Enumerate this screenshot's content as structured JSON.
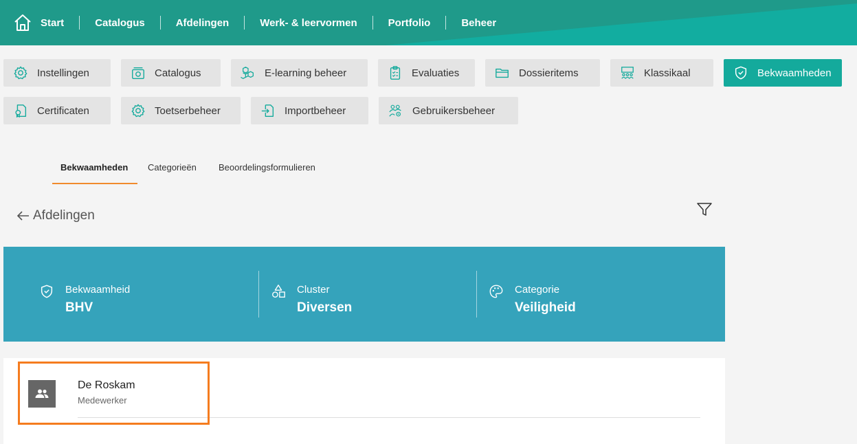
{
  "topnav": {
    "items": [
      "Start",
      "Catalogus",
      "Afdelingen",
      "Werk- & leervormen",
      "Portfolio",
      "Beheer"
    ]
  },
  "modules": [
    {
      "label": "Instellingen",
      "icon": "gear-icon"
    },
    {
      "label": "Catalogus",
      "icon": "catalog-icon"
    },
    {
      "label": "E-learning beheer",
      "icon": "cubes-icon"
    },
    {
      "label": "Evaluaties",
      "icon": "clipboard-icon"
    },
    {
      "label": "Dossieritems",
      "icon": "folder-icon"
    },
    {
      "label": "Klassikaal",
      "icon": "classroom-icon"
    },
    {
      "label": "Bekwaamheden",
      "icon": "shield-check-icon",
      "active": true
    },
    {
      "label": "Certificaten",
      "icon": "certificate-icon"
    },
    {
      "label": "Toetserbeheer",
      "icon": "gear-icon"
    },
    {
      "label": "Importbeheer",
      "icon": "import-icon"
    },
    {
      "label": "Gebruikersbeheer",
      "icon": "users-gear-icon"
    }
  ],
  "tabs": [
    "Bekwaamheden",
    "Categorieën",
    "Beoordelingsformulieren"
  ],
  "back_label": "Afdelingen",
  "panel": {
    "bekwaamheid": {
      "label": "Bekwaamheid",
      "value": "BHV"
    },
    "cluster": {
      "label": "Cluster",
      "value": "Diversen"
    },
    "categorie": {
      "label": "Categorie",
      "value": "Veiligheid"
    }
  },
  "list": [
    {
      "title": "De Roskam",
      "subtitle": "Medewerker"
    }
  ],
  "colors": {
    "nav_bg": "#1f9a8a",
    "accent": "#14aa9c",
    "panel_bg": "#35a3bb",
    "tab_underline": "#f08a2c",
    "highlight": "#f57c1f"
  }
}
